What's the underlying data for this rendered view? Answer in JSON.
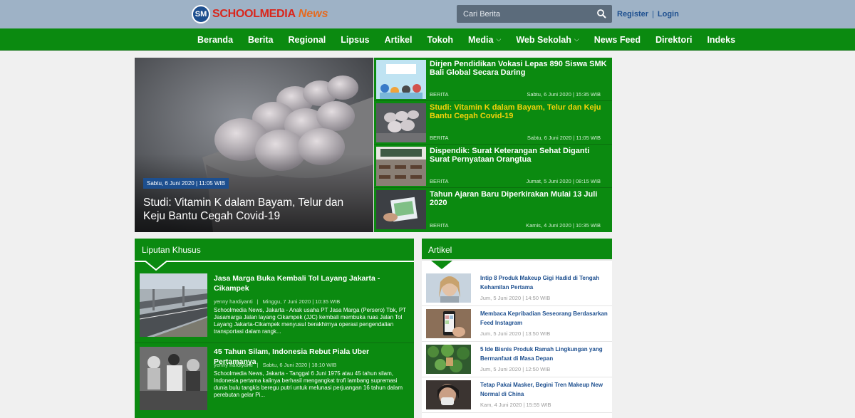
{
  "header": {
    "logo_mark": "SM",
    "logo_text": "SCHOOLMEDIA",
    "logo_news": "News",
    "search_placeholder": "Cari Berita",
    "register": "Register",
    "separator": "|",
    "login": "Login"
  },
  "nav": {
    "items": [
      {
        "label": "Beranda"
      },
      {
        "label": "Berita"
      },
      {
        "label": "Regional"
      },
      {
        "label": "Lipsus"
      },
      {
        "label": "Artikel"
      },
      {
        "label": "Tokoh"
      },
      {
        "label": "Media",
        "chevron": "⌵"
      },
      {
        "label": "Web Sekolah",
        "chevron": "⌵"
      },
      {
        "label": "News Feed"
      },
      {
        "label": "Direktori"
      },
      {
        "label": "Indeks"
      }
    ]
  },
  "headline": {
    "date": "Sabtu, 6 Juni 2020 | 11:05 WIB",
    "title": "Studi: Vitamin K dalam Bayam, Telur dan Keju Bantu Cegah Covid-19"
  },
  "side_news": [
    {
      "title": "Dirjen Pendidikan Vokasi Lepas 890 Siswa SMK Bali Global Secara Daring",
      "category": "BERITA",
      "date": "Sabtu, 6 Juni 2020 | 15:35 WIB"
    },
    {
      "title": "Studi: Vitamin K dalam Bayam, Telur dan Keju Bantu Cegah Covid-19",
      "category": "BERITA",
      "date": "Sabtu, 6 Juni 2020 | 11:05 WIB"
    },
    {
      "title": "Dispendik: Surat Keterangan Sehat Diganti Surat Pernyataan Orangtua",
      "category": "BERITA",
      "date": "Jumat, 5 Juni 2020 | 08:15 WIB"
    },
    {
      "title": "Tahun Ajaran Baru Diperkirakan Mulai 13 Juli 2020",
      "category": "BERITA",
      "date": "Kamis, 4 Juni 2020 | 10:35 WIB"
    }
  ],
  "liputan_khusus": {
    "title": "Liputan Khusus",
    "items": [
      {
        "title": "Jasa Marga Buka Kembali Tol Layang Jakarta - Cikampek",
        "author": "yenny hardiyanti",
        "date": "Minggu, 7 Juni 2020 | 10:35 WIB",
        "excerpt": "Schoolmedia News, Jakarta - Anak usaha PT Jasa Marga (Persero) Tbk, PT Jasamarga Jalan layang Cikampek (JJC) kembali membuka ruas Jalan Tol Layang Jakarta-Cikampek menyusul berakhirnya operasi pengendalian transportasi dalam rangk..."
      },
      {
        "title": "45 Tahun Silam, Indonesia Rebut Piala Uber Pertamanya",
        "author": "yenny hardiyanti",
        "date": "Sabtu, 6 Juni 2020 | 18:10 WIB",
        "excerpt": "Schoolmedia News, Jakarta - Tanggal 6 Juni 1975 atau 45 tahun silam, Indonesia pertama kalinya berhasil mengangkat trofi lambang supremasi dunia bulu tangkis beregu putri untuk melunasi perjuangan 16 tahun dalam perebutan gelar Pi..."
      }
    ]
  },
  "artikel": {
    "title": "Artikel",
    "items": [
      {
        "title": "Intip 8 Produk Makeup Gigi Hadid di Tengah Kehamilan Pertama",
        "date": "Jum, 5 Juni 2020 | 14:50 WIB"
      },
      {
        "title": "Membaca Kepribadian Seseorang Berdasarkan Feed Instagram",
        "date": "Jum, 5 Juni 2020 | 13:50 WIB"
      },
      {
        "title": "5 Ide Bisnis Produk Ramah Lingkungan yang Bermanfaat di Masa Depan",
        "date": "Jum, 5 Juni 2020 | 12:50 WIB"
      },
      {
        "title": "Tetap Pakai Masker, Begini Tren Makeup New Normal di China",
        "date": "Kam, 4 Juni 2020 | 15:55 WIB"
      }
    ]
  },
  "colors": {
    "green": "#0b8a10",
    "topbar": "#9eb2c6",
    "highlight": "#f5d20a",
    "link": "#1d4f8f"
  }
}
